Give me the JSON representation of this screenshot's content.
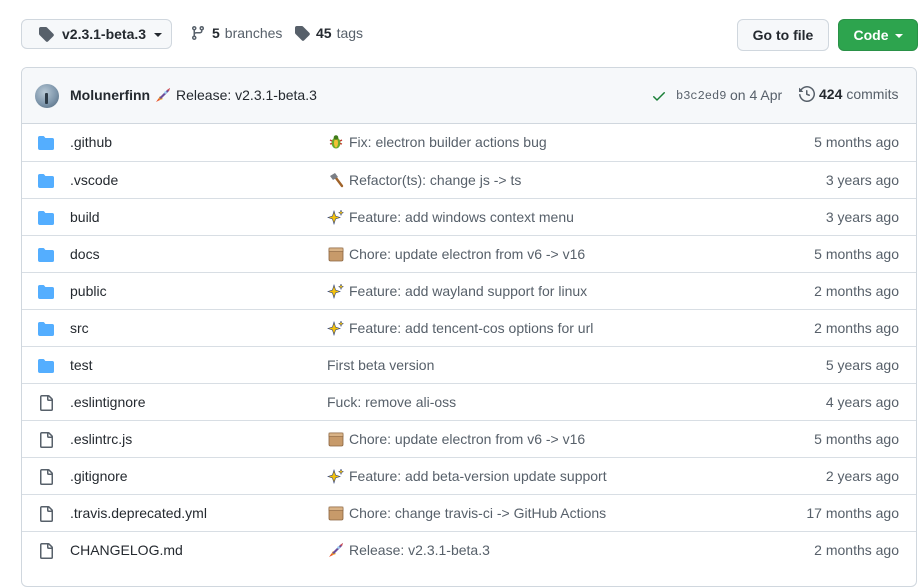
{
  "toolbar": {
    "branch_name": "v2.3.1-beta.3",
    "branches_count": "5",
    "branches_label": "branches",
    "tags_count": "45",
    "tags_label": "tags",
    "goto_file_label": "Go to file",
    "code_label": "Code"
  },
  "latest_commit": {
    "author": "Molunerfinn",
    "emoji": "rocket",
    "message": "Release: v2.3.1-beta.3",
    "sha": "b3c2ed9",
    "date": "on 4 Apr",
    "commits_count": "424",
    "commits_label": "commits"
  },
  "files": [
    {
      "name": ".github",
      "type": "folder",
      "emoji": "bug",
      "message": "Fix: electron builder actions bug",
      "age": "5 months ago"
    },
    {
      "name": ".vscode",
      "type": "folder",
      "emoji": "hammer",
      "message": "Refactor(ts): change js -> ts",
      "age": "3 years ago"
    },
    {
      "name": "build",
      "type": "folder",
      "emoji": "sparkles",
      "message": "Feature: add windows context menu",
      "age": "3 years ago"
    },
    {
      "name": "docs",
      "type": "folder",
      "emoji": "package",
      "message": "Chore: update electron from v6 -> v16",
      "age": "5 months ago"
    },
    {
      "name": "public",
      "type": "folder",
      "emoji": "sparkles",
      "message": "Feature: add wayland support for linux",
      "age": "2 months ago"
    },
    {
      "name": "src",
      "type": "folder",
      "emoji": "sparkles",
      "message": "Feature: add tencent-cos options for url",
      "age": "2 months ago"
    },
    {
      "name": "test",
      "type": "folder",
      "emoji": "",
      "message": "First beta version",
      "age": "5 years ago"
    },
    {
      "name": ".eslintignore",
      "type": "file",
      "emoji": "",
      "message": "Fuck: remove ali-oss",
      "age": "4 years ago"
    },
    {
      "name": ".eslintrc.js",
      "type": "file",
      "emoji": "package",
      "message": "Chore: update electron from v6 -> v16",
      "age": "5 months ago"
    },
    {
      "name": ".gitignore",
      "type": "file",
      "emoji": "sparkles",
      "message": "Feature: add beta-version update support",
      "age": "2 years ago"
    },
    {
      "name": ".travis.deprecated.yml",
      "type": "file",
      "emoji": "package",
      "message": "Chore: change travis-ci -> GitHub Actions",
      "age": "17 months ago"
    },
    {
      "name": "CHANGELOG.md",
      "type": "file",
      "emoji": "rocket",
      "message": "Release: v2.3.1-beta.3",
      "age": "2 months ago"
    }
  ],
  "colors": {
    "accent_green": "#2da44e",
    "folder_blue": "#54aeff",
    "muted_text": "#57606a",
    "border": "#d0d7de"
  }
}
